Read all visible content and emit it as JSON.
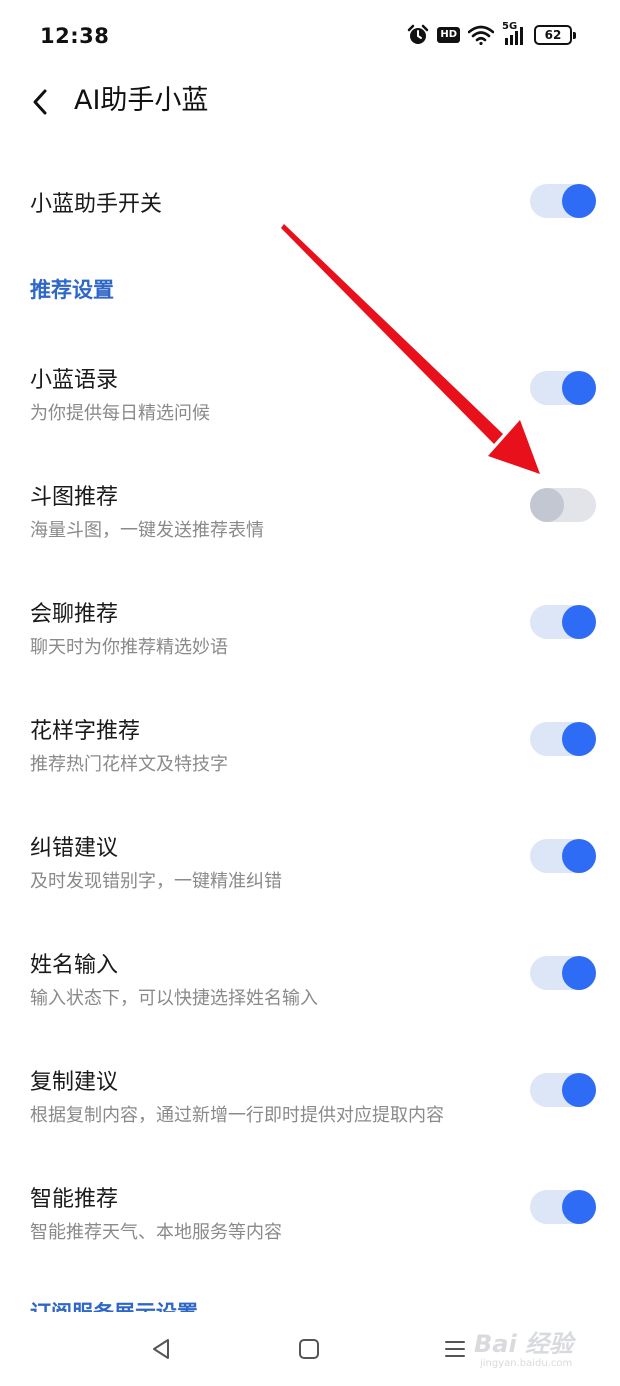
{
  "status_bar": {
    "time": "12:38",
    "hd": "HD",
    "network": "5G",
    "battery": "62"
  },
  "header": {
    "title": "AI助手小蓝"
  },
  "master_switch": {
    "label": "小蓝助手开关",
    "on": true
  },
  "recommend_section": {
    "title": "推荐设置"
  },
  "settings": [
    {
      "title": "小蓝语录",
      "subtitle": "为你提供每日精选问候",
      "on": true
    },
    {
      "title": "斗图推荐",
      "subtitle": "海量斗图，一键发送推荐表情",
      "on": false
    },
    {
      "title": "会聊推荐",
      "subtitle": "聊天时为你推荐精选妙语",
      "on": true
    },
    {
      "title": "花样字推荐",
      "subtitle": "推荐热门花样文及特技字",
      "on": true
    },
    {
      "title": "纠错建议",
      "subtitle": "及时发现错别字，一键精准纠错",
      "on": true
    },
    {
      "title": "姓名输入",
      "subtitle": "输入状态下，可以快捷选择姓名输入",
      "on": true
    },
    {
      "title": "复制建议",
      "subtitle": "根据复制内容，通过新增一行即时提供对应提取内容",
      "on": true
    },
    {
      "title": "智能推荐",
      "subtitle": "智能推荐天气、本地服务等内容",
      "on": true
    }
  ],
  "next_section": {
    "title": "订阅服务展示设置"
  },
  "watermark": {
    "main": "Bai 经验",
    "sub": "jingyan.baidu.com"
  },
  "colors": {
    "accent": "#2e6cf6",
    "section_header": "#2f67c8",
    "toggle_on_track": "#dce6f7",
    "toggle_off_track": "#e2e4ea",
    "annotation_arrow": "#e8101a"
  }
}
